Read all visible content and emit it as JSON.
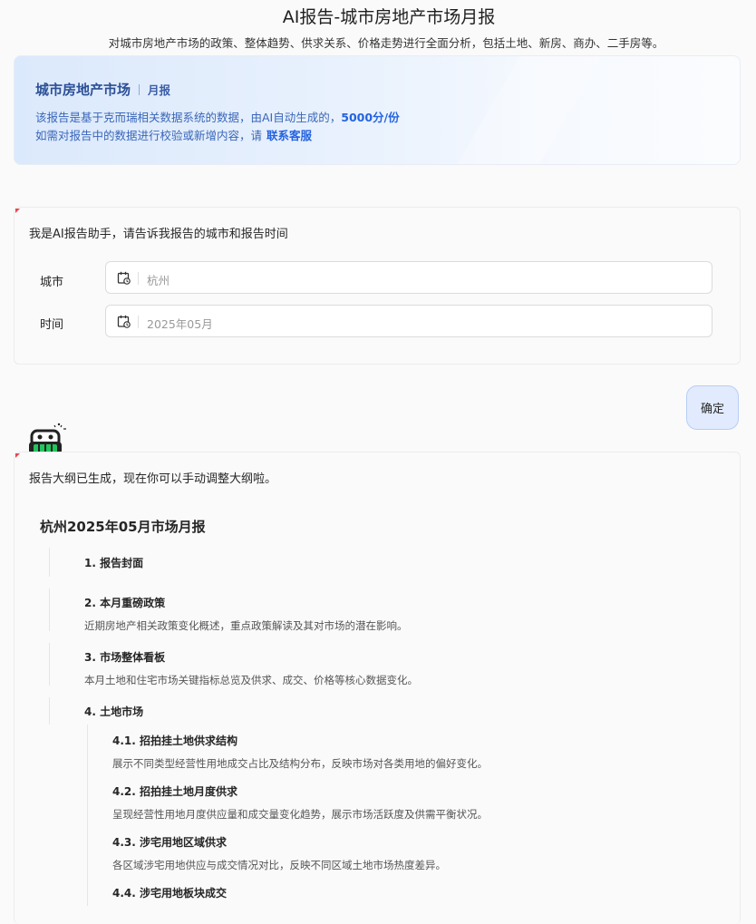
{
  "header": {
    "title": "AI报告-城市房地产市场月报",
    "subtitle": "对城市房地产市场的政策、整体趋势、供求关系、价格走势进行全面分析，包括土地、新房、商办、二手房等。"
  },
  "banner": {
    "title": "城市房地产市场",
    "tag": "月报",
    "line1_text": "该报告是基于克而瑞相关数据系统的数据，由AI自动生成的，",
    "price": "5000分/份",
    "line2_text": "如需对报告中的数据进行校验或新增内容，请",
    "contact_link": "联系客服"
  },
  "form": {
    "prompt": "我是AI报告助手，请告诉我报告的城市和报告时间",
    "city_label": "城市",
    "city_value": "杭州",
    "time_label": "时间",
    "time_value": "2025年05月"
  },
  "confirm_button": "确定",
  "outline": {
    "note": "报告大纲已生成，现在你可以手动调整大纲啦。",
    "title": "杭州2025年05月市场月报",
    "sections": [
      {
        "heading": "1. 报告封面",
        "desc": ""
      },
      {
        "heading": "2. 本月重磅政策",
        "desc": "近期房地产相关政策变化概述，重点政策解读及其对市场的潜在影响。"
      },
      {
        "heading": "3. 市场整体看板",
        "desc": "本月土地和住宅市场关键指标总览及供求、成交、价格等核心数据变化。"
      },
      {
        "heading": "4. 土地市场",
        "desc": ""
      }
    ],
    "subsections": [
      {
        "heading": "4.1. 招拍挂土地供求结构",
        "desc": "展示不同类型经营性用地成交占比及结构分布，反映市场对各类用地的偏好变化。"
      },
      {
        "heading": "4.2. 招拍挂土地月度供求",
        "desc": "呈现经营性用地月度供应量和成交量变化趋势，展示市场活跃度及供需平衡状况。"
      },
      {
        "heading": "4.3. 涉宅用地区域供求",
        "desc": "各区域涉宅用地供应与成交情况对比，反映不同区域土地市场热度差异。"
      },
      {
        "heading": "4.4. 涉宅用地板块成交",
        "desc": ""
      }
    ]
  },
  "colors": {
    "accent": "#2463e0",
    "confirm_bg": "#e1ebfd",
    "robot_green": "#22c55e",
    "corner_red": "#e5484d"
  },
  "icons": [
    "calendar-icon",
    "robot-avatar-icon"
  ]
}
